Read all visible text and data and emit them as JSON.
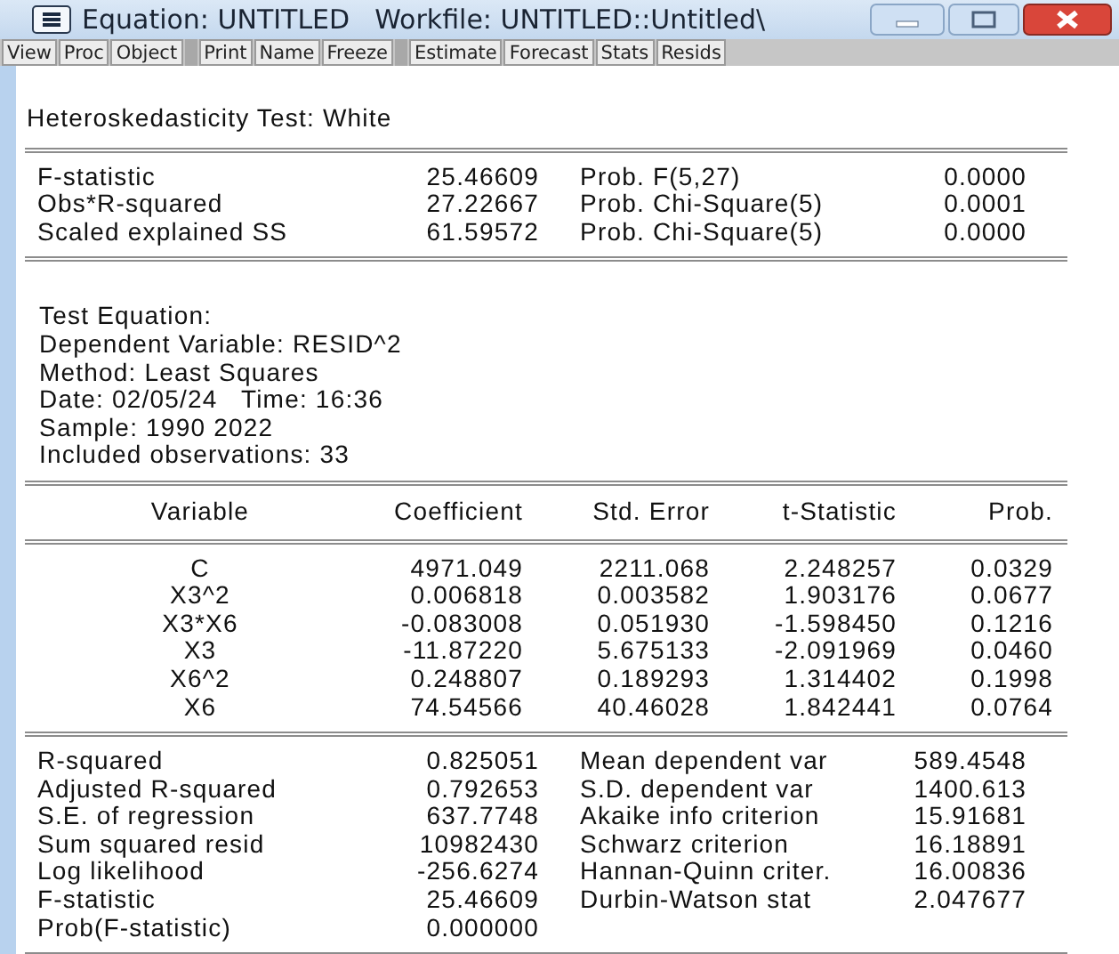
{
  "window": {
    "title": "Equation: UNTITLED",
    "workfile": "Workfile: UNTITLED::Untitled\\"
  },
  "toolbar": [
    [
      "View",
      "Proc",
      "Object"
    ],
    [
      "Print",
      "Name",
      "Freeze"
    ],
    [
      "Estimate",
      "Forecast",
      "Stats",
      "Resids"
    ]
  ],
  "test": {
    "title": "Heteroskedasticity Test: White",
    "rows": [
      {
        "label": "F-statistic",
        "value": "25.46609",
        "stat_label": "Prob. F(5,27)",
        "stat_value": "0.0000"
      },
      {
        "label": "Obs*R-squared",
        "value": "27.22667",
        "stat_label": "Prob. Chi-Square(5)",
        "stat_value": "0.0001"
      },
      {
        "label": "Scaled explained SS",
        "value": "61.59572",
        "stat_label": "Prob. Chi-Square(5)",
        "stat_value": "0.0000"
      }
    ]
  },
  "equation_info": [
    "Test Equation:",
    "Dependent Variable: RESID^2",
    "Method: Least Squares",
    "Date: 02/05/24   Time: 16:36",
    "Sample: 1990 2022",
    "Included observations: 33"
  ],
  "coefficients": {
    "columns": [
      "Variable",
      "Coefficient",
      "Std. Error",
      "t-Statistic",
      "Prob."
    ],
    "rows": [
      [
        "C",
        "4971.049",
        "2211.068",
        "2.248257",
        "0.0329"
      ],
      [
        "X3^2",
        "0.006818",
        "0.003582",
        "1.903176",
        "0.0677"
      ],
      [
        "X3*X6",
        "-0.083008",
        "0.051930",
        "-1.598450",
        "0.1216"
      ],
      [
        "X3",
        "-11.87220",
        "5.675133",
        "-2.091969",
        "0.0460"
      ],
      [
        "X6^2",
        "0.248807",
        "0.189293",
        "1.314402",
        "0.1998"
      ],
      [
        "X6",
        "74.54566",
        "40.46028",
        "1.842441",
        "0.0764"
      ]
    ]
  },
  "statistics": [
    {
      "label": "R-squared",
      "value": "0.825051",
      "label_2": "Mean dependent var",
      "value_2": "589.4548"
    },
    {
      "label": "Adjusted R-squared",
      "value": "0.792653",
      "label_2": "S.D. dependent var",
      "value_2": "1400.613"
    },
    {
      "label": "S.E. of regression",
      "value": "637.7748",
      "label_2": "Akaike info criterion",
      "value_2": "15.91681"
    },
    {
      "label": "Sum squared resid",
      "value": "10982430",
      "label_2": "Schwarz criterion",
      "value_2": "16.18891"
    },
    {
      "label": "Log likelihood",
      "value": "-256.6274",
      "label_2": "Hannan-Quinn criter.",
      "value_2": "16.00836"
    },
    {
      "label": "F-statistic",
      "value": "25.46609",
      "label_2": "Durbin-Watson stat",
      "value_2": "2.047677"
    },
    {
      "label": "Prob(F-statistic)",
      "value": "0.000000"
    }
  ]
}
